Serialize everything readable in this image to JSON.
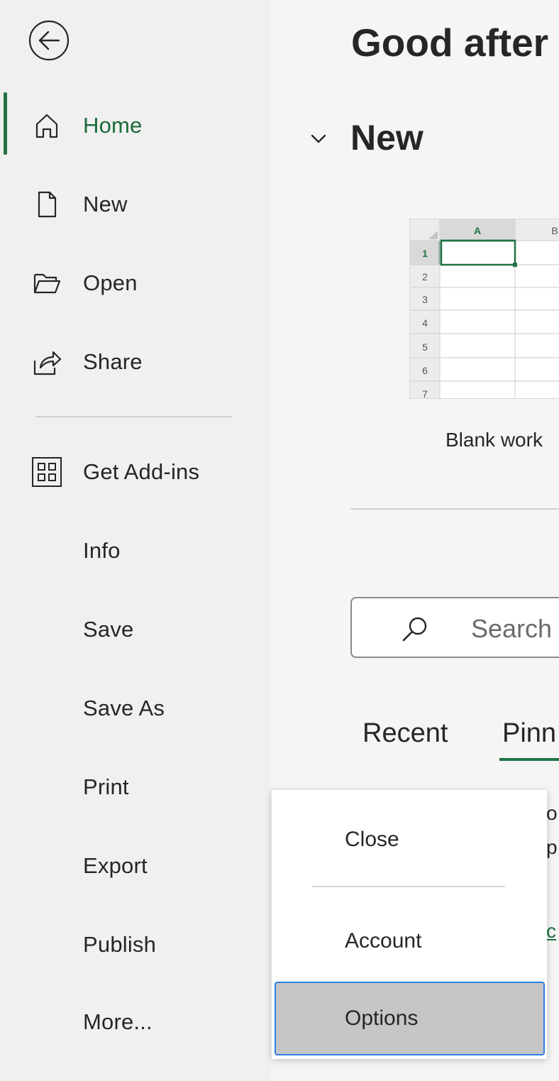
{
  "sidebar": {
    "back_label": "Back",
    "items": [
      {
        "label": "Home",
        "icon": "home-icon"
      },
      {
        "label": "New",
        "icon": "new-document-icon"
      },
      {
        "label": "Open",
        "icon": "open-folder-icon"
      },
      {
        "label": "Share",
        "icon": "share-icon"
      },
      {
        "label": "Get Add-ins",
        "icon": "add-ins-icon"
      },
      {
        "label": "Info"
      },
      {
        "label": "Save"
      },
      {
        "label": "Save As"
      },
      {
        "label": "Print"
      },
      {
        "label": "Export"
      },
      {
        "label": "Publish"
      },
      {
        "label": "More..."
      }
    ],
    "active_item": "Home"
  },
  "main": {
    "greeting": "Good after",
    "section_title": "New",
    "template": {
      "label": "Blank work",
      "columns": [
        "A",
        "B"
      ],
      "rows": [
        "1",
        "2",
        "3",
        "4",
        "5",
        "6",
        "7"
      ]
    },
    "search_placeholder": "Search",
    "tabs": [
      {
        "label": "Recent"
      },
      {
        "label": "Pinn"
      }
    ],
    "active_tab": "Pinn"
  },
  "popup_menu": {
    "items": [
      {
        "label": "Close"
      },
      {
        "label": "Account"
      },
      {
        "label": "Options"
      }
    ],
    "highlighted": "Options"
  },
  "colors": {
    "accent_green": "#217346",
    "focus_blue": "#2f7ee6"
  }
}
